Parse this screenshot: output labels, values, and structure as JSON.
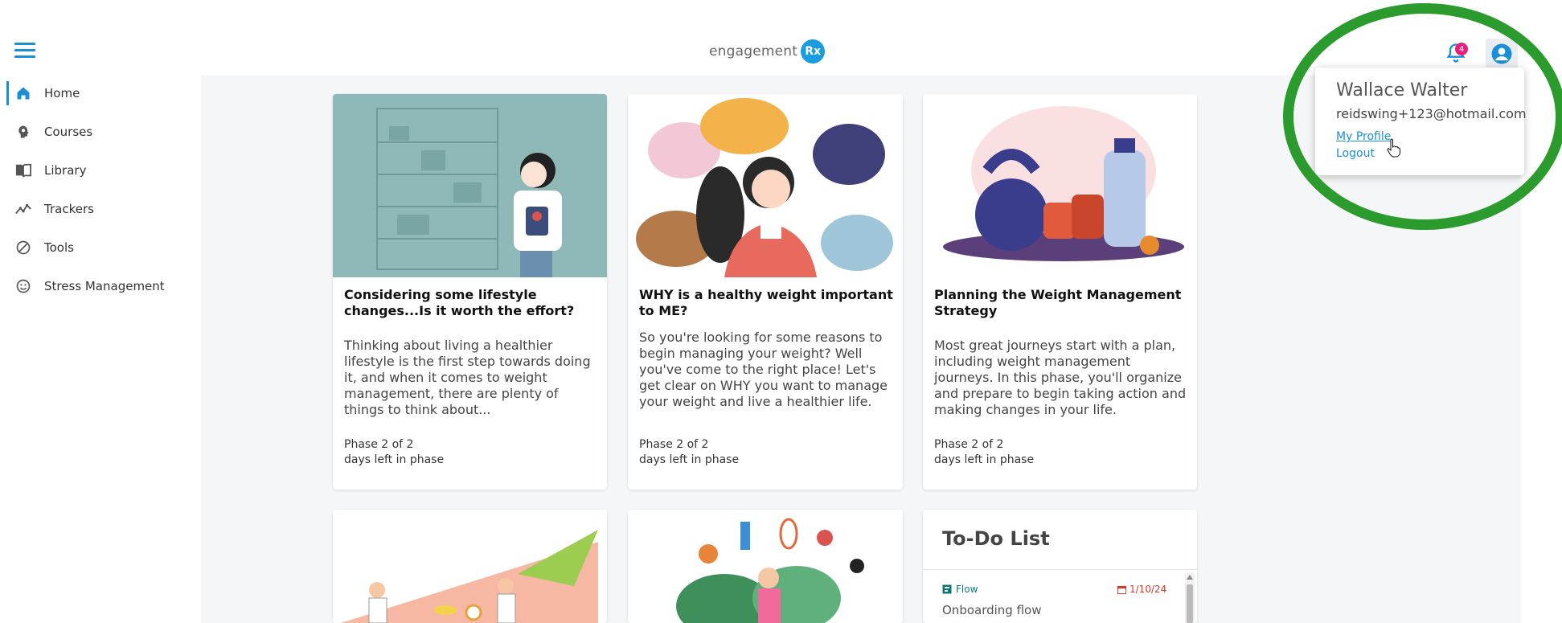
{
  "header": {
    "logo_text": "engagement",
    "logo_badge": "Rx",
    "notification_count": "4"
  },
  "sidebar": {
    "items": [
      {
        "label": "Home",
        "icon": "home-icon",
        "active": true
      },
      {
        "label": "Courses",
        "icon": "courses-icon"
      },
      {
        "label": "Library",
        "icon": "library-icon"
      },
      {
        "label": "Trackers",
        "icon": "trackers-icon"
      },
      {
        "label": "Tools",
        "icon": "tools-icon"
      },
      {
        "label": "Stress Management",
        "icon": "smile-icon"
      }
    ]
  },
  "cards": [
    {
      "title": "Considering some lifestyle changes...Is it worth the effort?",
      "description": "Thinking about living a healthier lifestyle is the first step towards doing it, and when it comes to weight management, there are plenty of things to think about...",
      "phase": "Phase 2 of 2",
      "days_left": "days left in phase"
    },
    {
      "title": "WHY is a healthy weight important to ME?",
      "description": "So you're looking for some reasons to begin managing your weight? Well you've come to the right place! Let's get clear on WHY you want to manage your weight and live a healthier life.",
      "phase": "Phase 2 of 2",
      "days_left": "days left in phase"
    },
    {
      "title": "Planning the Weight Management Strategy",
      "description": "Most great journeys start with a plan, including weight management journeys. In this phase, you'll organize and prepare to begin taking action and making changes in your life.",
      "phase": "Phase 2 of 2",
      "days_left": "days left in phase"
    }
  ],
  "todo": {
    "title": "To-Do List",
    "items": [
      {
        "type": "Flow",
        "date": "1/10/24",
        "name": "Onboarding flow"
      }
    ]
  },
  "profile_menu": {
    "name": "Wallace Walter",
    "email": "reidswing+123@hotmail.com",
    "my_profile": "My Profile",
    "logout": "Logout"
  },
  "colors": {
    "accent": "#1a8fd6",
    "highlight_ring": "#2b9b2e",
    "badge": "#e6207a"
  }
}
